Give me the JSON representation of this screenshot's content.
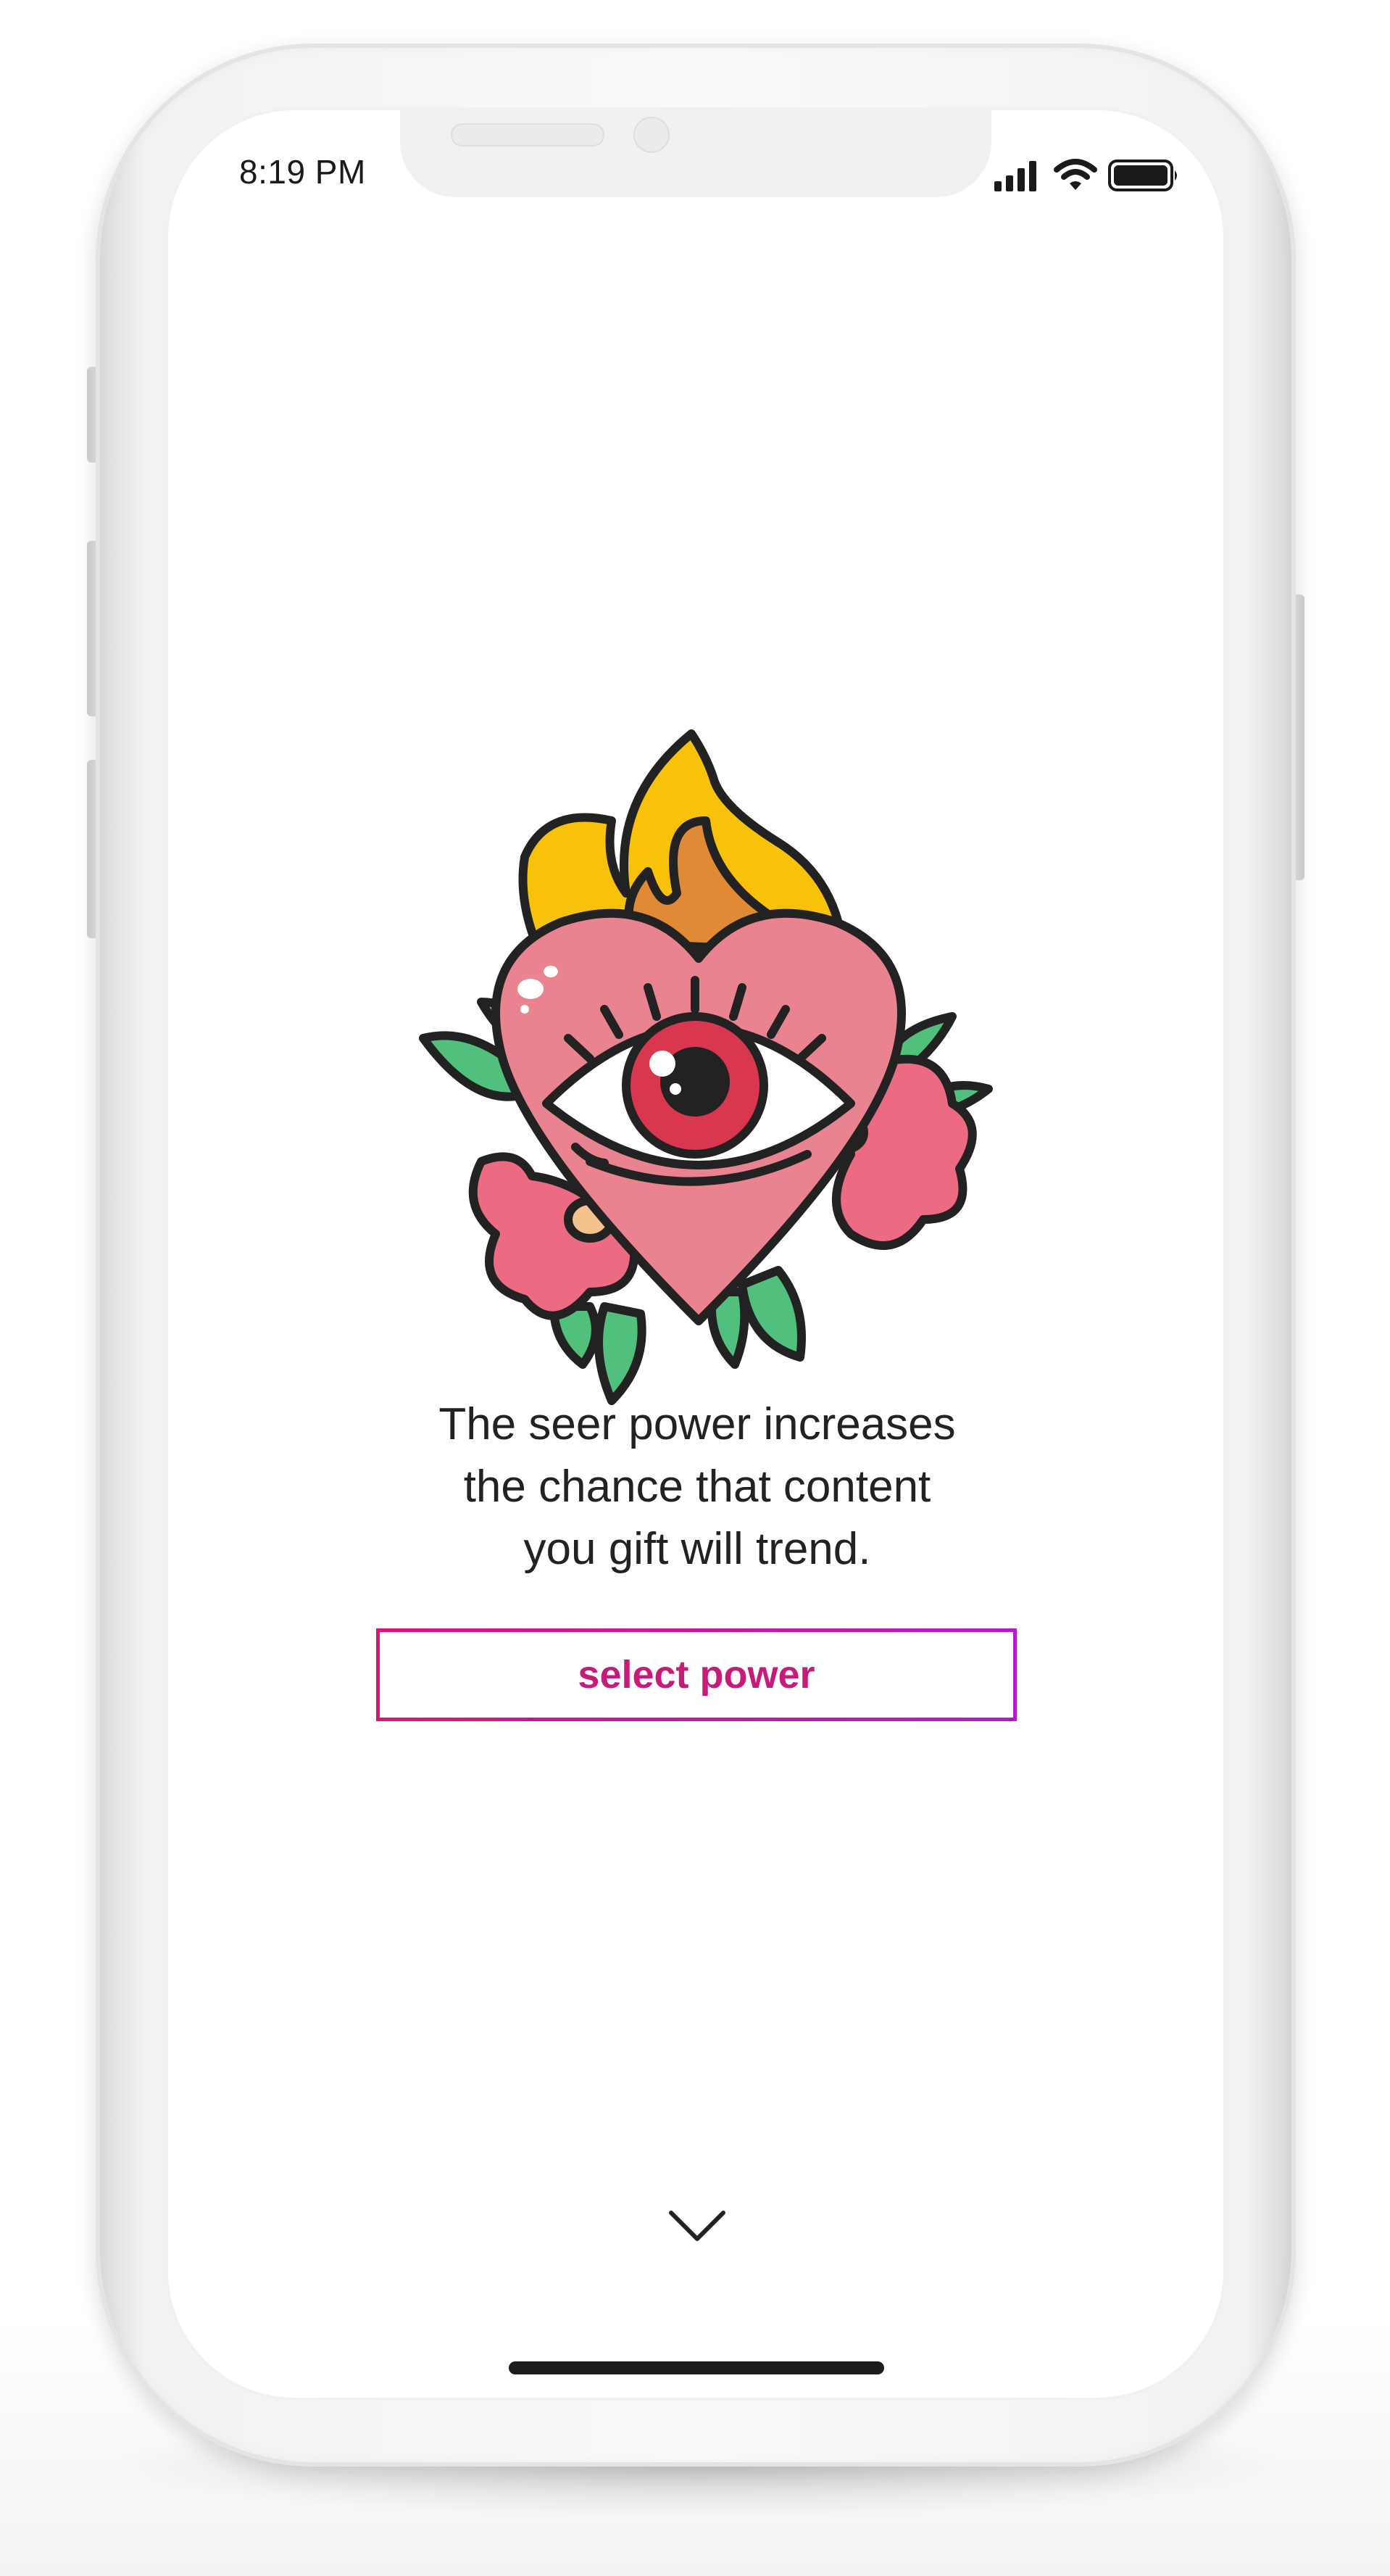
{
  "status_bar": {
    "time": "8:19 PM",
    "icons": [
      "cellular-signal-icon",
      "wifi-icon",
      "battery-icon"
    ]
  },
  "illustration": {
    "name": "flaming-heart-eye-illustration"
  },
  "message": {
    "line1": "The seer power increases",
    "line2": "the chance that content",
    "line3": "you gift will trend."
  },
  "actions": {
    "select_label": "select power",
    "next_icon": "chevron-down-icon"
  },
  "colors": {
    "accent_start": "#d8157a",
    "accent_end": "#b01cc8",
    "heart_pink": "#e9838f",
    "flame_yellow": "#f7c207",
    "flame_orange": "#e08a36",
    "leaf_green": "#52c07d",
    "flower_pink": "#ec6a82",
    "iris_red": "#d9364f"
  }
}
